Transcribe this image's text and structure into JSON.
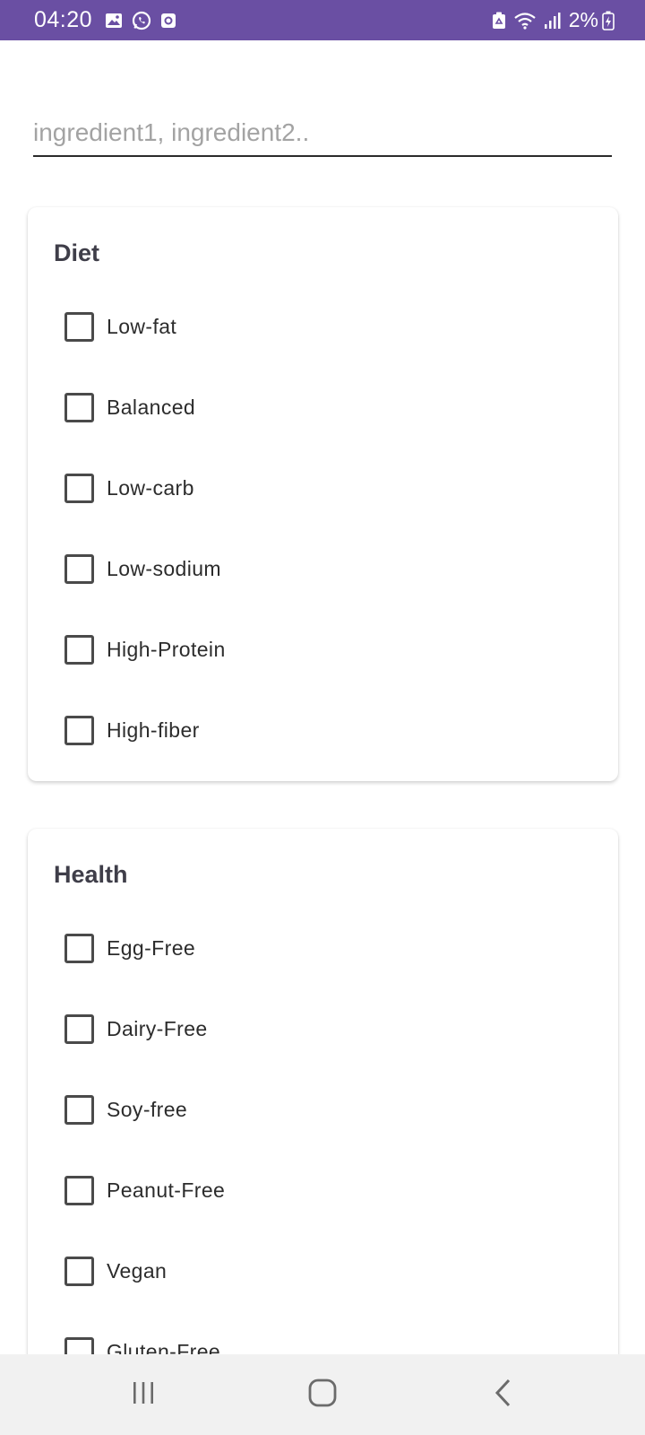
{
  "status_bar": {
    "time": "04:20",
    "left_icons": [
      "gallery-icon",
      "whatsapp-icon",
      "app-notification-icon"
    ],
    "right_icons": [
      "recycle-icon",
      "wifi-icon",
      "signal-icon"
    ],
    "battery": "2%",
    "background_color": "#6a4fa3"
  },
  "search": {
    "placeholder": "ingredient1, ingredient2..",
    "value": ""
  },
  "diet": {
    "title": "Diet",
    "options": [
      {
        "label": "Low-fat",
        "checked": false
      },
      {
        "label": "Balanced",
        "checked": false
      },
      {
        "label": "Low-carb",
        "checked": false
      },
      {
        "label": "Low-sodium",
        "checked": false
      },
      {
        "label": "High-Protein",
        "checked": false
      },
      {
        "label": "High-fiber",
        "checked": false
      }
    ]
  },
  "health": {
    "title": "Health",
    "options": [
      {
        "label": "Egg-Free",
        "checked": false
      },
      {
        "label": "Dairy-Free",
        "checked": false
      },
      {
        "label": "Soy-free",
        "checked": false
      },
      {
        "label": "Peanut-Free",
        "checked": false
      },
      {
        "label": "Vegan",
        "checked": false
      },
      {
        "label": "Gluten-Free",
        "checked": false
      }
    ]
  },
  "nav_bar": {
    "buttons": [
      "recent-apps-icon",
      "home-icon",
      "back-icon"
    ]
  }
}
